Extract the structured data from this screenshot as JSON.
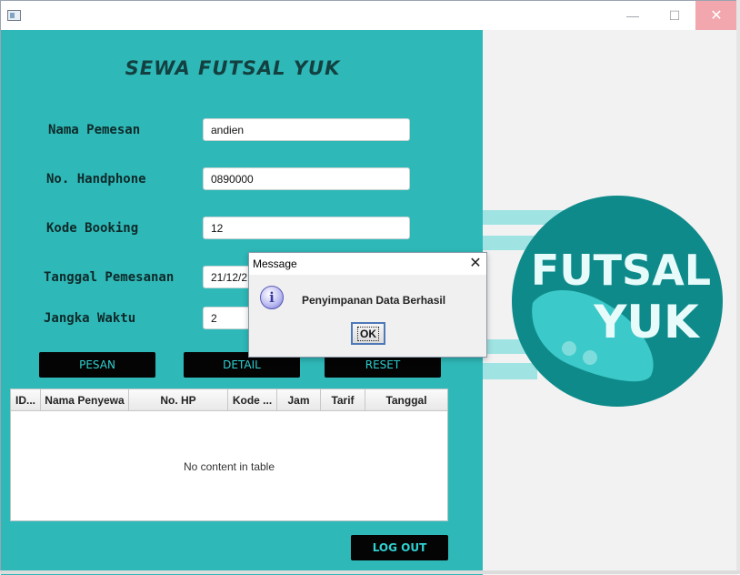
{
  "window": {
    "minimize_glyph": "—",
    "maximize_glyph": "☐",
    "close_glyph": "✕"
  },
  "app_title": "SEWA FUTSAL YUK",
  "form": {
    "nama_label": "Nama Pemesan",
    "nama_value": "andien",
    "hp_label": "No. Handphone",
    "hp_value": "0890000",
    "kode_label": "Kode Booking",
    "kode_value": "12",
    "tanggal_label": "Tanggal Pemesanan",
    "tanggal_value": "21/12/2",
    "jangka_label": "Jangka Waktu",
    "jangka_value": "2"
  },
  "buttons": {
    "pesan": "PESAN",
    "detail": "DETAIL",
    "reset": "RESET",
    "logout": "LOG OUT"
  },
  "table": {
    "columns": [
      "ID...",
      "Nama Penyewa",
      "No. HP",
      "Kode ...",
      "Jam",
      "Tarif",
      "Tanggal"
    ],
    "empty_message": "No content in table"
  },
  "logo": {
    "line1": "FUTSAL",
    "line2": "YUK"
  },
  "dialog": {
    "title": "Message",
    "close_glyph": "✕",
    "message": "Penyimpanan Data Berhasil",
    "ok_label": "OK"
  },
  "colors": {
    "panel_teal": "#2fb8b8",
    "button_black": "#040404",
    "button_text": "#2fd0d0",
    "logo_dark": "#0f8a8a",
    "logo_light": "#3cc9c9"
  },
  "icons": {
    "app": "window-app-icon",
    "info": "info-icon"
  }
}
